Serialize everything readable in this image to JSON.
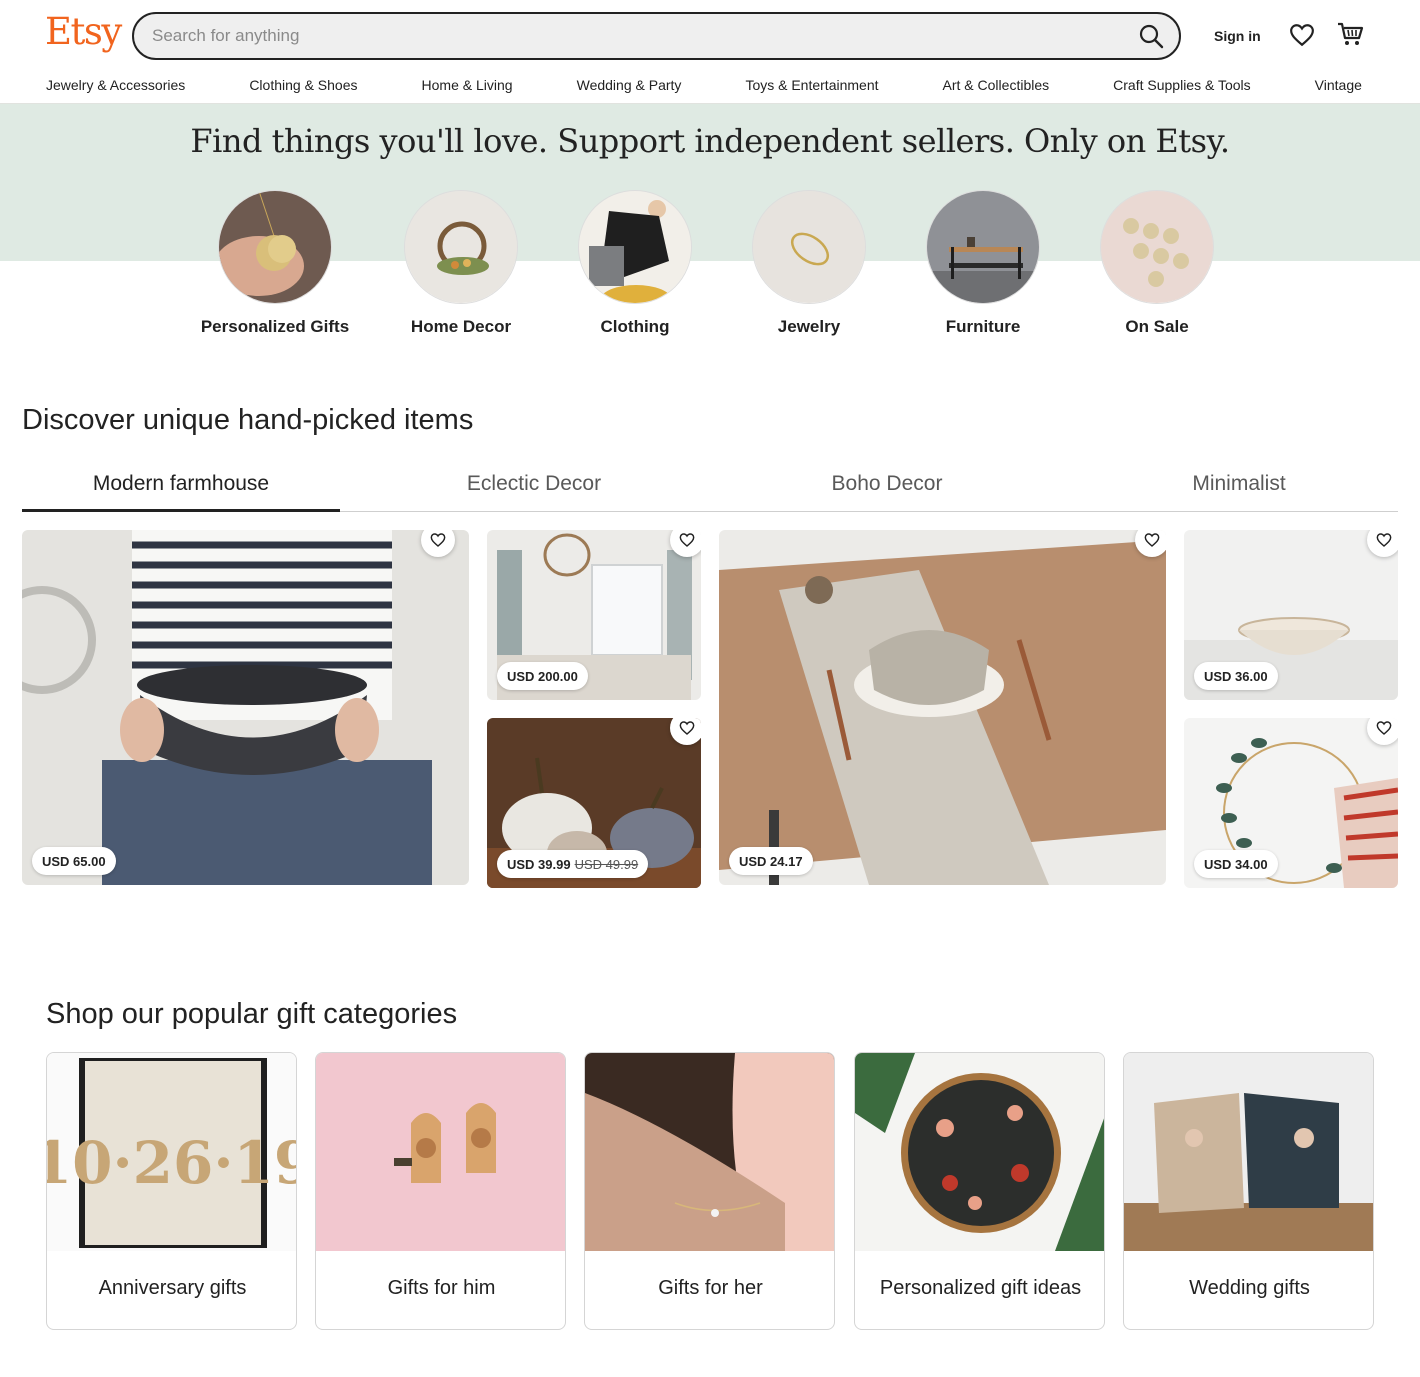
{
  "brand": {
    "logo": "Etsy",
    "accent": "#f1641e"
  },
  "search": {
    "placeholder": "Search for anything",
    "value": ""
  },
  "header": {
    "sign_in": "Sign in"
  },
  "nav": {
    "items": [
      "Jewelry & Accessories",
      "Clothing & Shoes",
      "Home & Living",
      "Wedding & Party",
      "Toys & Entertainment",
      "Art & Collectibles",
      "Craft Supplies & Tools",
      "Vintage"
    ]
  },
  "hero": {
    "title": "Find things you'll love. Support independent sellers. Only on Etsy.",
    "band_color": "#dfeae3",
    "circles": [
      "Personalized Gifts",
      "Home Decor",
      "Clothing",
      "Jewelry",
      "Furniture",
      "On Sale"
    ]
  },
  "discover": {
    "title": "Discover unique hand-picked items",
    "tabs": [
      "Modern farmhouse",
      "Eclectic Decor",
      "Boho Decor",
      "Minimalist"
    ],
    "active_tab": "Modern farmhouse",
    "items": [
      {
        "price": "USD 65.00"
      },
      {
        "price": "USD 200.00"
      },
      {
        "price": "USD 39.99",
        "original_price": "USD 49.99"
      },
      {
        "price": "USD 24.17"
      },
      {
        "price": "USD 36.00"
      },
      {
        "price": "USD 34.00"
      }
    ]
  },
  "gifts": {
    "title": "Shop our popular gift categories",
    "categories": [
      "Anniversary gifts",
      "Gifts for him",
      "Gifts for her",
      "Personalized gift ideas",
      "Wedding gifts"
    ]
  }
}
